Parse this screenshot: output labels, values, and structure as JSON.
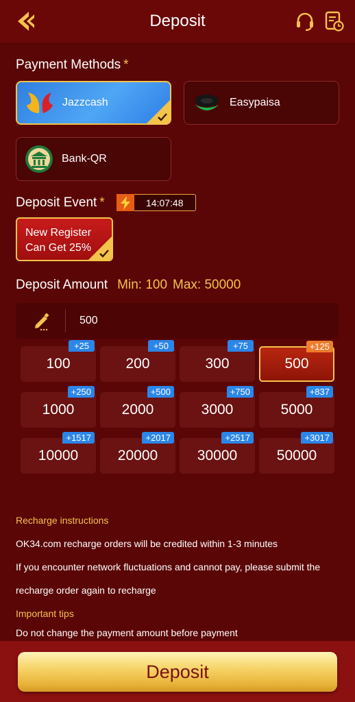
{
  "header": {
    "title": "Deposit",
    "back_icon": "back-arrow-icon",
    "support_icon": "headset-icon",
    "records_icon": "history-icon"
  },
  "payment": {
    "label": "Payment Methods",
    "required_mark": "*",
    "methods": [
      {
        "name": "Jazzcash",
        "selected": true
      },
      {
        "name": "Easypaisa",
        "selected": false
      },
      {
        "name": "Bank-QR",
        "selected": false
      }
    ]
  },
  "event": {
    "label": "Deposit Event",
    "required_mark": "*",
    "timer": "14:07:48",
    "card_line1": "New Register",
    "card_line2": "Can Get 25%"
  },
  "amount": {
    "label": "Deposit Amount",
    "min": "Min: 100",
    "max": "Max: 50000",
    "input_value": "500",
    "options": [
      {
        "value": "100",
        "bonus": "+25"
      },
      {
        "value": "200",
        "bonus": "+50"
      },
      {
        "value": "300",
        "bonus": "+75"
      },
      {
        "value": "500",
        "bonus": "+125",
        "selected": true
      },
      {
        "value": "1000",
        "bonus": "+250"
      },
      {
        "value": "2000",
        "bonus": "+500"
      },
      {
        "value": "3000",
        "bonus": "+750"
      },
      {
        "value": "5000",
        "bonus": "+837"
      },
      {
        "value": "10000",
        "bonus": "+1517"
      },
      {
        "value": "20000",
        "bonus": "+2017"
      },
      {
        "value": "30000",
        "bonus": "+2517"
      },
      {
        "value": "50000",
        "bonus": "+3017"
      }
    ]
  },
  "instructions": {
    "heading": "Recharge instructions",
    "line1": "OK34.com recharge orders will be credited within 1-3 minutes",
    "line2": "If you encounter network fluctuations and cannot pay, please submit the",
    "line3": "recharge order again to recharge",
    "tips_heading": "Important tips",
    "tip1": "Do not change the payment amount before payment"
  },
  "footer": {
    "deposit_label": "Deposit"
  },
  "colors": {
    "background": "#5a0606",
    "accent": "#f4c34c",
    "bonus_badge": "#2b86e8",
    "selected_badge": "#ef7d2c"
  }
}
